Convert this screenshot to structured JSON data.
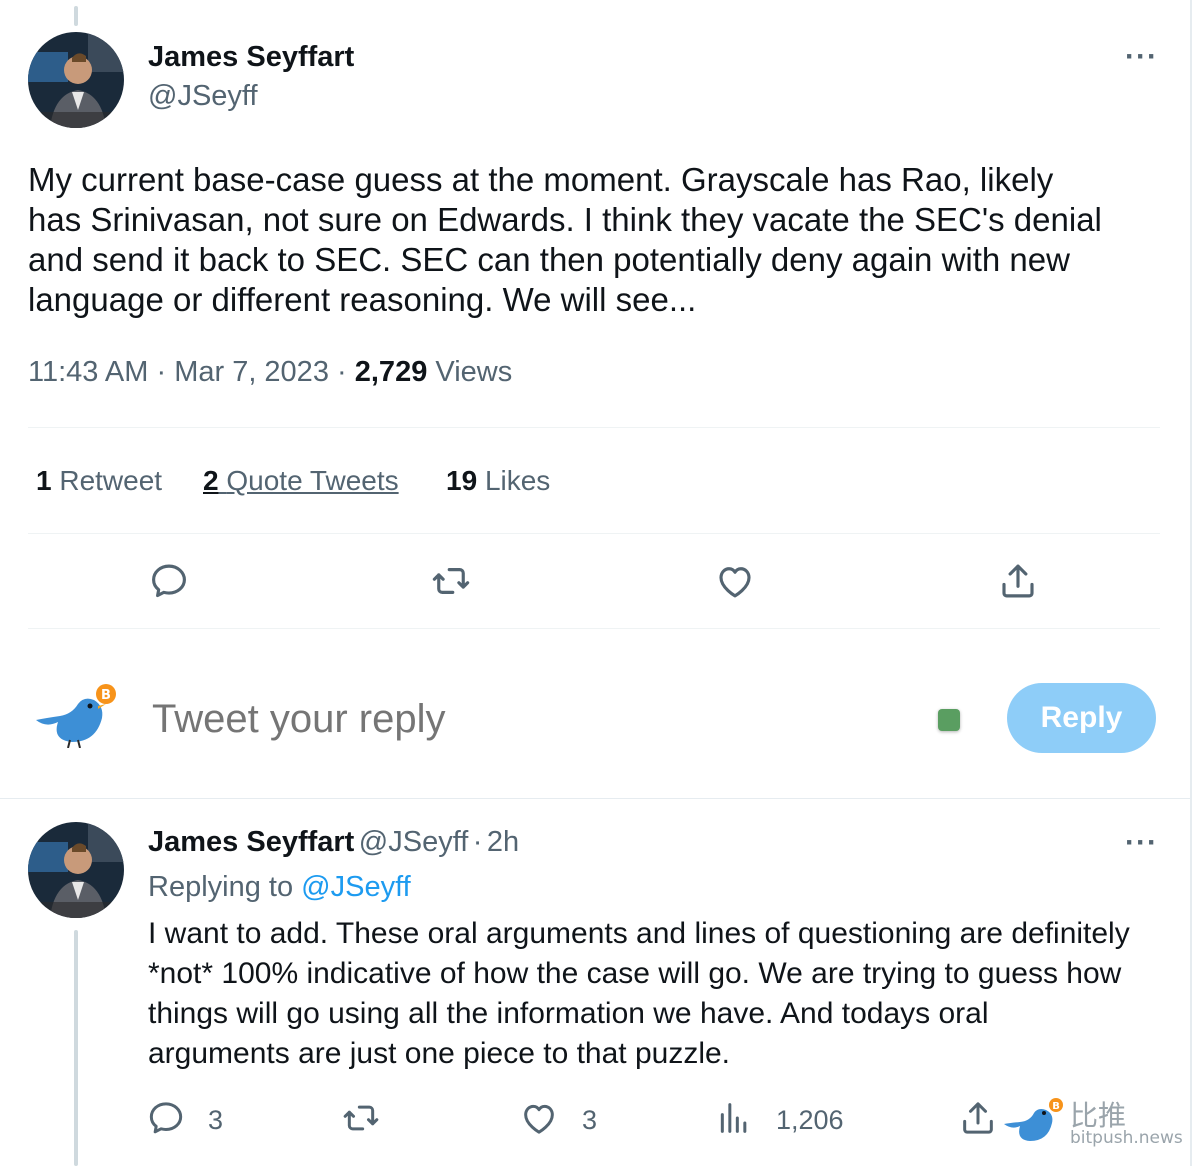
{
  "main_tweet": {
    "author_name": "James Seyffart",
    "author_handle": "@JSeyff",
    "text_lines": [
      "My current base-case guess at the moment. Grayscale has Rao, likely",
      "has Srinivasan, not sure on Edwards. I think they vacate the SEC's denial",
      "and send it back to SEC. SEC can then potentially deny again with new",
      "language or different reasoning. We will see..."
    ],
    "time": "11:43 AM",
    "sep": "·",
    "date": "Mar 7, 2023",
    "views_count": "2,729",
    "views_label": "Views",
    "stats": {
      "retweets_count": "1",
      "retweets_label": "Retweet",
      "quotes_count": "2",
      "quotes_label": "Quote Tweets",
      "likes_count": "19",
      "likes_label": "Likes"
    }
  },
  "composer": {
    "placeholder": "Tweet your reply",
    "reply_button": "Reply"
  },
  "reply_tweet": {
    "author_name": "James Seyffart",
    "author_handle": "@JSeyff",
    "sep": "·",
    "age": "2h",
    "replying_prefix": "Replying to",
    "replying_handle": "@JSeyff",
    "text_lines": [
      "I want to add. These oral arguments and lines of questioning are definitely",
      "*not* 100% indicative of how the case will go. We are trying to guess how",
      "things will go using all the information we have. And todays oral",
      "arguments are just one piece to that puzzle."
    ],
    "replies_count": "3",
    "likes_count": "3",
    "views_count": "1,206"
  },
  "watermark": {
    "brand_cn": "比推",
    "brand_en": "bitpush.news"
  },
  "colors": {
    "accent": "#1d9bf0",
    "reply_button_disabled": "#8ecdf8",
    "secondary_text": "#536471"
  }
}
